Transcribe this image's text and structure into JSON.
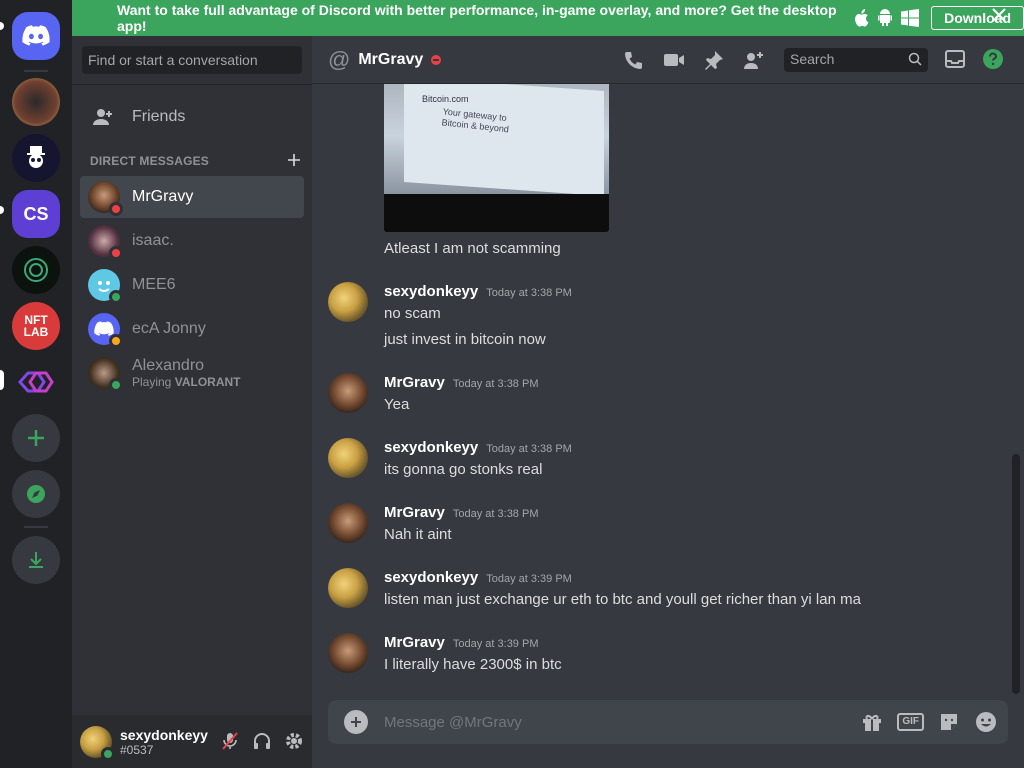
{
  "banner": {
    "message": "Want to take full advantage of Discord with better performance, in-game overlay, and more? Get the desktop app!",
    "download_label": "Download"
  },
  "sidebar": {
    "search_placeholder": "Find or start a conversation",
    "friends_label": "Friends",
    "dm_header": "DIRECT MESSAGES",
    "dms": [
      {
        "name": "MrGravy",
        "status": "dnd",
        "active": true
      },
      {
        "name": "isaac.",
        "status": "dnd"
      },
      {
        "name": "MEE6",
        "status": "online"
      },
      {
        "name": "ecA Jonny",
        "status": "idle"
      },
      {
        "name": "Alexandro",
        "status": "online",
        "activity_prefix": "Playing ",
        "activity_game": "VALORANT"
      }
    ]
  },
  "user_panel": {
    "username": "sexydonkeyy",
    "tag": "#0537"
  },
  "header": {
    "title": "MrGravy",
    "search_placeholder": "Search"
  },
  "messages": {
    "continued_text": "Atleast I am not scamming",
    "groups": [
      {
        "author": "sexydonkeyy",
        "timestamp": "Today at 3:38 PM",
        "lines": [
          "no scam",
          "just invest in bitcoin now"
        ]
      },
      {
        "author": "MrGravy",
        "timestamp": "Today at 3:38 PM",
        "lines": [
          "Yea"
        ]
      },
      {
        "author": "sexydonkeyy",
        "timestamp": "Today at 3:38 PM",
        "lines": [
          "its gonna go stonks real"
        ]
      },
      {
        "author": "MrGravy",
        "timestamp": "Today at 3:38 PM",
        "lines": [
          "Nah it aint"
        ]
      },
      {
        "author": "sexydonkeyy",
        "timestamp": "Today at 3:39 PM",
        "lines": [
          "listen man just exchange ur eth to btc and youll get richer than yi lan ma"
        ]
      },
      {
        "author": "MrGravy",
        "timestamp": "Today at 3:39 PM",
        "lines": [
          "I literally have 2300$ in btc"
        ]
      }
    ],
    "attachment_text": [
      "Bitcoin.com",
      "Your gateway to Bitcoin & beyond"
    ]
  },
  "servers": [
    {
      "label": "CS"
    },
    {
      "label": "NFT LAB"
    }
  ],
  "composer": {
    "placeholder": "Message @MrGravy",
    "gif_label": "GIF"
  },
  "colors": {
    "blurple": "#5865f2",
    "green": "#3ba55d",
    "dnd": "#ed4245",
    "idle": "#faa81a"
  }
}
